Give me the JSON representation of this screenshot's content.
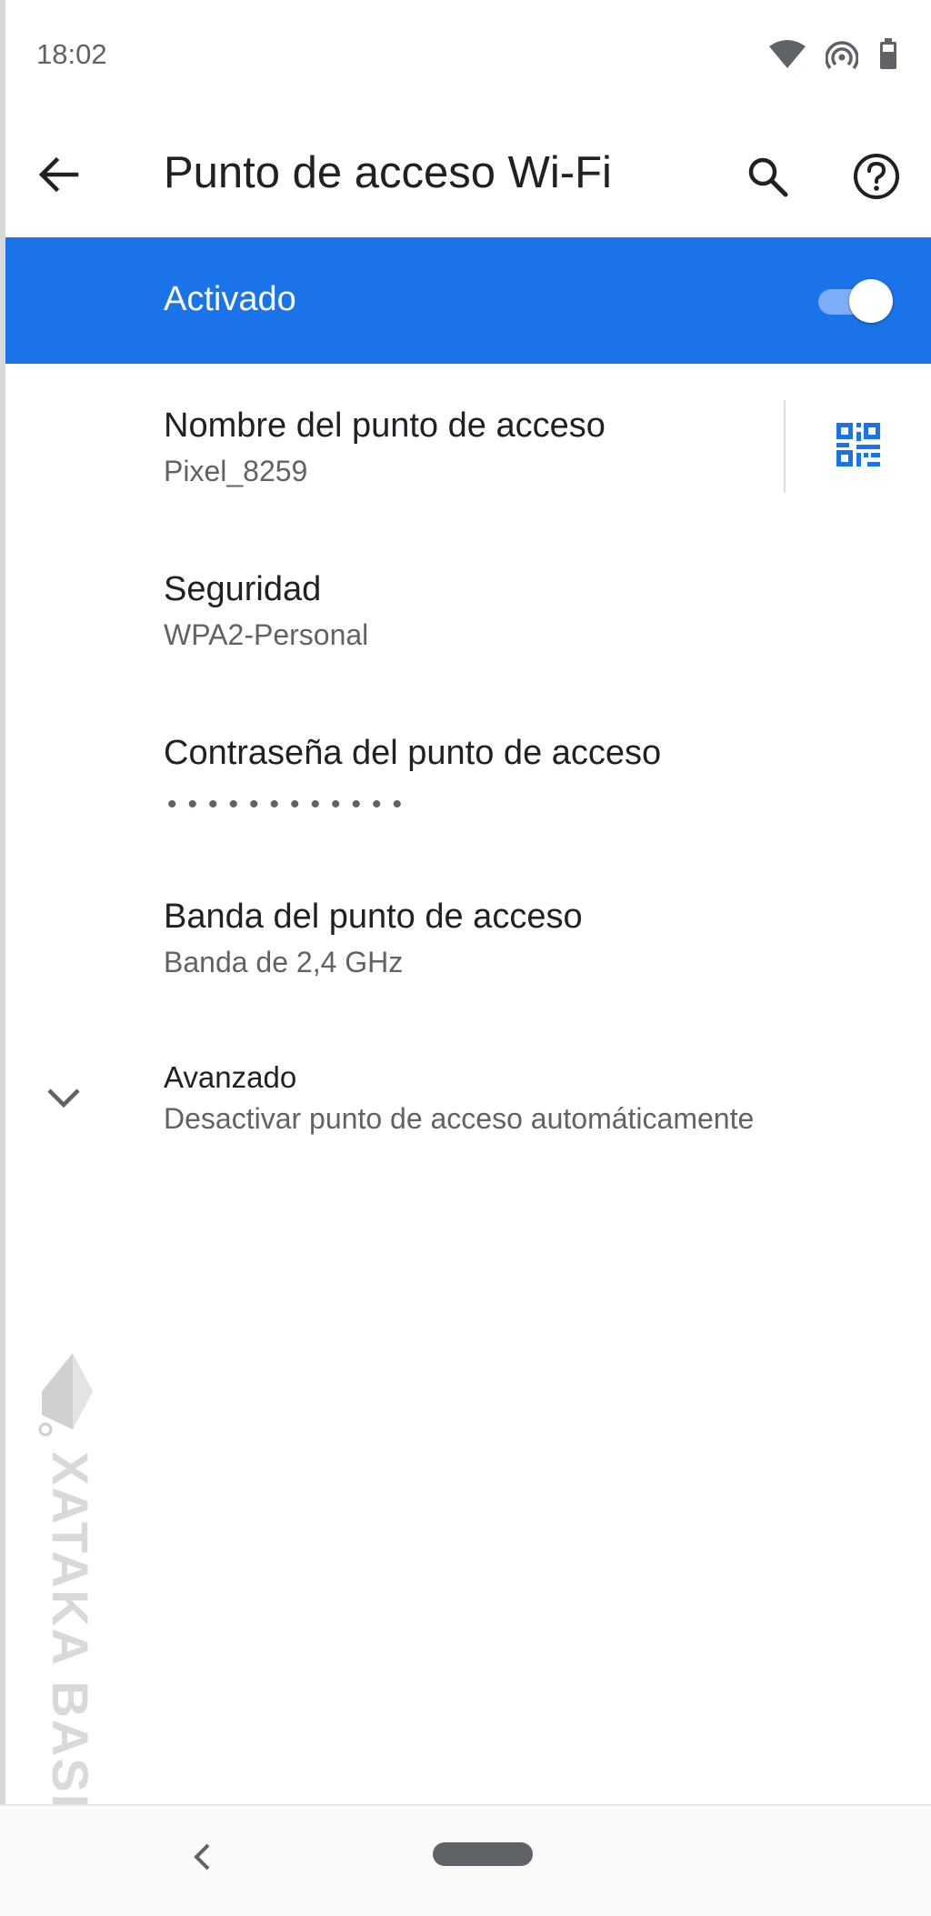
{
  "status_bar": {
    "time": "18:02",
    "icons": [
      "wifi-icon",
      "hotspot-icon",
      "battery-icon"
    ]
  },
  "app_bar": {
    "title": "Punto de acceso Wi-Fi",
    "icons": [
      "back-arrow-icon",
      "search-icon",
      "help-icon"
    ]
  },
  "master_switch": {
    "label": "Activado",
    "state": "on",
    "color": "#1a73e8"
  },
  "settings": {
    "hotspot_name": {
      "title": "Nombre del punto de acceso",
      "value": "Pixel_8259"
    },
    "security": {
      "title": "Seguridad",
      "value": "WPA2-Personal"
    },
    "password": {
      "title": "Contraseña del punto de acceso",
      "value": "••••••••••••"
    },
    "band": {
      "title": "Banda del punto de acceso",
      "value": "Banda de 2,4 GHz"
    },
    "advanced": {
      "title": "Avanzado",
      "value": "Desactivar punto de acceso automáticamente"
    }
  },
  "watermark": {
    "text": "XATAKA BASICS"
  },
  "nav_bar": {
    "icons": [
      "nav-back-icon",
      "nav-home-pill"
    ]
  }
}
